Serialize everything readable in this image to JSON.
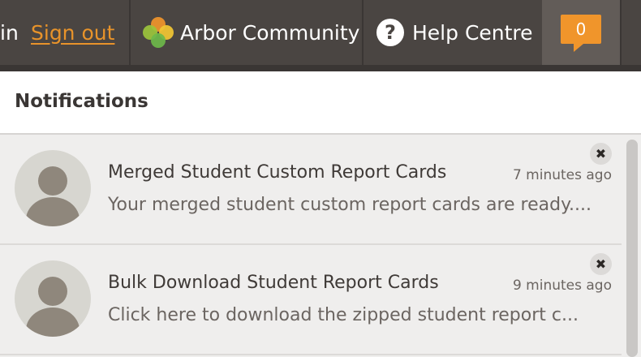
{
  "topbar": {
    "signin_prefix": "in",
    "signout_label": "Sign out",
    "community_label": "Arbor Community",
    "help_label": "Help Centre",
    "help_icon_glyph": "?",
    "notification_count": "0",
    "colors": {
      "bar": "#4a4542",
      "accent": "#e8932a",
      "badge": "#f0952b"
    }
  },
  "panel": {
    "title": "Notifications",
    "items": [
      {
        "title": "Merged Student Custom Report Cards",
        "time": "7 minutes ago",
        "message": "Your merged student custom report cards are ready....",
        "close_glyph": "✖"
      },
      {
        "title": "Bulk Download Student Report Cards",
        "time": "9 minutes ago",
        "message": "Click here to download the zipped student report c...",
        "close_glyph": "✖"
      }
    ]
  },
  "icons": [
    "arbor-logo-icon",
    "help-icon",
    "avatar-icon",
    "close-icon"
  ]
}
